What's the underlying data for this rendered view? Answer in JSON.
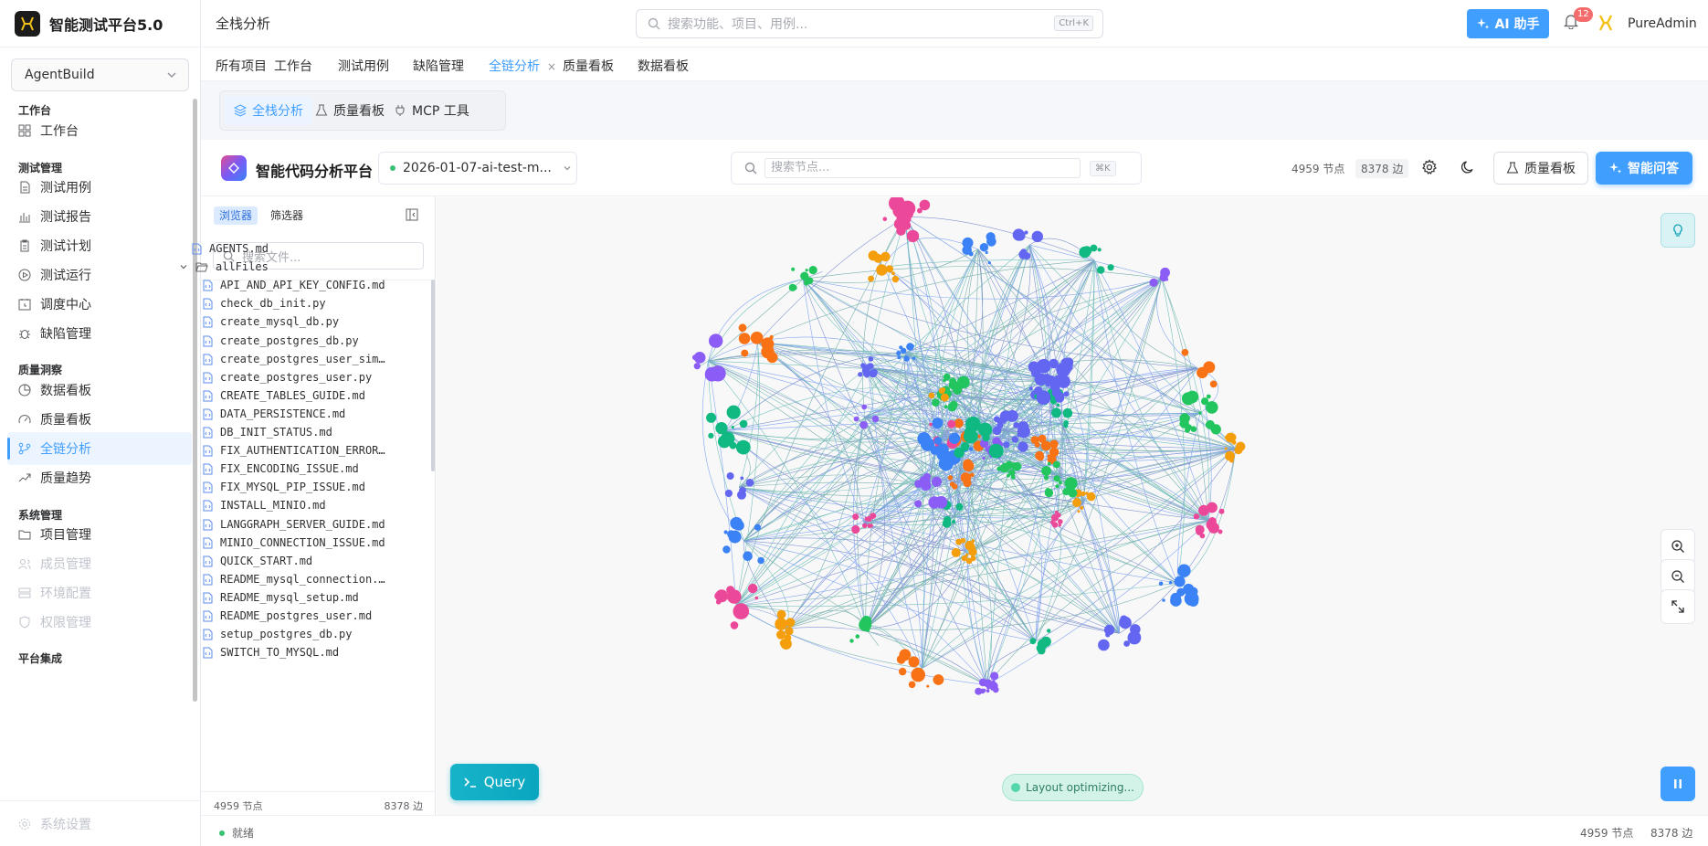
{
  "brand": {
    "title": "智能测试平台5.0"
  },
  "project_select": {
    "value": "AgentBuild"
  },
  "sidebar": {
    "groups": [
      {
        "label": "工作台",
        "items": [
          {
            "label": "工作台"
          }
        ]
      },
      {
        "label": "测试管理",
        "items": [
          {
            "label": "测试用例"
          },
          {
            "label": "测试报告"
          },
          {
            "label": "测试计划"
          },
          {
            "label": "测试运行"
          },
          {
            "label": "调度中心"
          },
          {
            "label": "缺陷管理"
          }
        ]
      },
      {
        "label": "质量洞察",
        "items": [
          {
            "label": "数据看板"
          },
          {
            "label": "质量看板"
          },
          {
            "label": "全链分析"
          },
          {
            "label": "质量趋势"
          }
        ]
      },
      {
        "label": "系统管理",
        "items": [
          {
            "label": "项目管理"
          },
          {
            "label": "成员管理"
          },
          {
            "label": "环境配置"
          },
          {
            "label": "权限管理"
          }
        ]
      },
      {
        "label": "平台集成",
        "items": []
      }
    ],
    "footer_item": "系统设置"
  },
  "header": {
    "title": "全栈分析",
    "search_placeholder": "搜索功能、项目、用例...",
    "search_shortcut": "Ctrl+K",
    "ai_button": "AI 助手",
    "notification_count": "12",
    "user_name": "PureAdmin"
  },
  "tabs": [
    {
      "label": "所有项目"
    },
    {
      "label": "工作台"
    },
    {
      "label": "测试用例"
    },
    {
      "label": "缺陷管理"
    },
    {
      "label": "全链分析",
      "active": true,
      "close": "×"
    },
    {
      "label": "质量看板"
    },
    {
      "label": "数据看板"
    }
  ],
  "segments": [
    {
      "label": "全栈分析",
      "icon": "layers-icon",
      "active": true
    },
    {
      "label": "质量看板",
      "icon": "flask-icon"
    },
    {
      "label": "MCP 工具",
      "icon": "plug-icon"
    }
  ],
  "app": {
    "name": "智能代码分析平台",
    "repo": "2026-01-07-ai-test-m...",
    "node_search_placeholder": "搜索节点...",
    "node_search_shortcut": "⌘K",
    "nodes_stat": "4959 节点",
    "edges_stat": "8378 边",
    "quality_button": "质量看板",
    "ask_button": "智能问答"
  },
  "file_panel": {
    "tabs": [
      "浏览器",
      "筛选器"
    ],
    "search_placeholder": "搜索文件...",
    "files": [
      {
        "name": "AGENTS.md",
        "type": "file",
        "depth": 0
      },
      {
        "name": "allFiles",
        "type": "folder",
        "depth": 0,
        "expanded": true
      },
      {
        "name": "API_AND_API_KEY_CONFIG.md",
        "type": "file",
        "depth": 1
      },
      {
        "name": "check_db_init.py",
        "type": "file",
        "depth": 1
      },
      {
        "name": "create_mysql_db.py",
        "type": "file",
        "depth": 1
      },
      {
        "name": "create_postgres_db.py",
        "type": "file",
        "depth": 1
      },
      {
        "name": "create_postgres_user_sim…",
        "type": "file",
        "depth": 1
      },
      {
        "name": "create_postgres_user.py",
        "type": "file",
        "depth": 1
      },
      {
        "name": "CREATE_TABLES_GUIDE.md",
        "type": "file",
        "depth": 1
      },
      {
        "name": "DATA_PERSISTENCE.md",
        "type": "file",
        "depth": 1
      },
      {
        "name": "DB_INIT_STATUS.md",
        "type": "file",
        "depth": 1
      },
      {
        "name": "FIX_AUTHENTICATION_ERROR…",
        "type": "file",
        "depth": 1
      },
      {
        "name": "FIX_ENCODING_ISSUE.md",
        "type": "file",
        "depth": 1
      },
      {
        "name": "FIX_MYSQL_PIP_ISSUE.md",
        "type": "file",
        "depth": 1
      },
      {
        "name": "INSTALL_MINIO.md",
        "type": "file",
        "depth": 1
      },
      {
        "name": "LANGGRAPH_SERVER_GUIDE.md",
        "type": "file",
        "depth": 1
      },
      {
        "name": "MINIO_CONNECTION_ISSUE.md",
        "type": "file",
        "depth": 1
      },
      {
        "name": "QUICK_START.md",
        "type": "file",
        "depth": 1
      },
      {
        "name": "README_mysql_connection.…",
        "type": "file",
        "depth": 1
      },
      {
        "name": "README_mysql_setup.md",
        "type": "file",
        "depth": 1
      },
      {
        "name": "README_postgres_user.md",
        "type": "file",
        "depth": 1
      },
      {
        "name": "setup_postgres_db.py",
        "type": "file",
        "depth": 1
      },
      {
        "name": "SWITCH_TO_MYSQL.md",
        "type": "file",
        "depth": 1
      }
    ],
    "footer_nodes": "4959 节点",
    "footer_edges": "8378 边"
  },
  "graph": {
    "query_button": "Query",
    "layout_status": "Layout optimizing...",
    "node_colors": [
      "#f59e0b",
      "#ec4899",
      "#3b82f6",
      "#6366f1",
      "#10b981",
      "#8b5cf6",
      "#f97316",
      "#22c55e"
    ],
    "edge_colors": [
      "#1e40af",
      "#0f766e",
      "#2563eb",
      "#0d9488"
    ]
  },
  "status_bar": {
    "status": "就绪",
    "nodes": "4959 节点",
    "edges": "8378 边"
  },
  "colors": {
    "accent": "#409eff",
    "teal": "#0aa6c0",
    "success": "#3ac071"
  }
}
